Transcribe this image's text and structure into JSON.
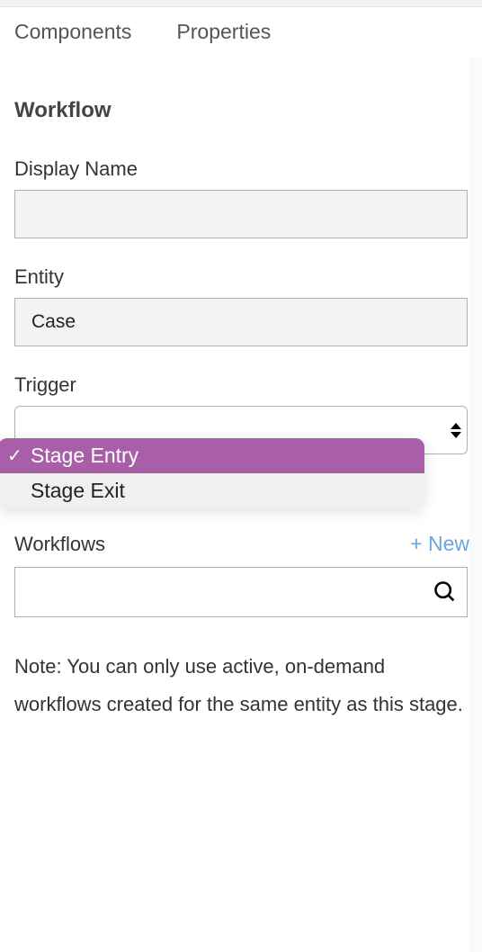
{
  "tabs": {
    "components": "Components",
    "properties": "Properties"
  },
  "section": {
    "title": "Workflow"
  },
  "fields": {
    "display_name": {
      "label": "Display Name",
      "value": ""
    },
    "entity": {
      "label": "Entity",
      "value": "Case"
    },
    "trigger": {
      "label": "Trigger",
      "options": [
        {
          "label": "Stage Entry",
          "selected": true
        },
        {
          "label": "Stage Exit",
          "selected": false
        }
      ]
    },
    "workflows": {
      "label": "Workflows",
      "new_label": "+ New",
      "search_value": ""
    }
  },
  "note": "Note: You can only use active, on-demand workflows created for the same entity as this stage."
}
